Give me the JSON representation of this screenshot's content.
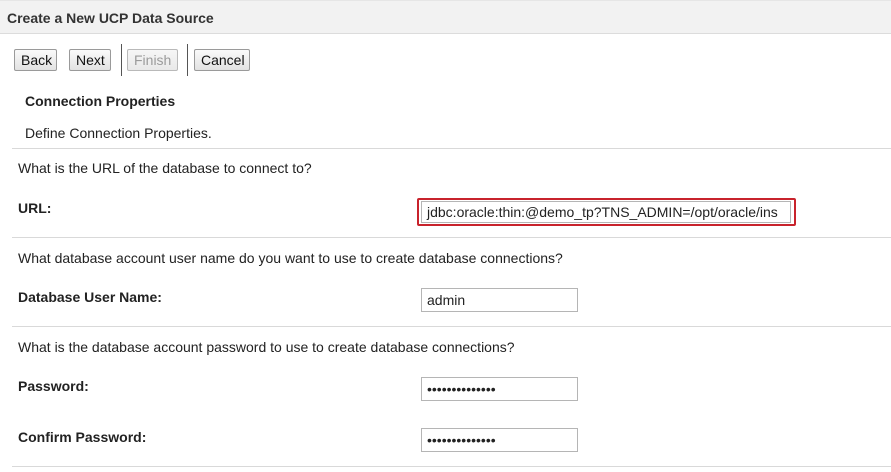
{
  "header": {
    "title": "Create a New UCP Data Source"
  },
  "toolbar": {
    "back_label": "Back",
    "next_label": "Next",
    "finish_label": "Finish",
    "cancel_label": "Cancel"
  },
  "section": {
    "title": "Connection Properties",
    "description": "Define Connection Properties."
  },
  "url_block": {
    "question": "What is the URL of the database to connect to?",
    "label": "URL:",
    "value": "jdbc:oracle:thin:@demo_tp?TNS_ADMIN=/opt/oracle/ins"
  },
  "user_block": {
    "question": "What database account user name do you want to use to create database connections?",
    "label": "Database User Name:",
    "value": "admin"
  },
  "password_block": {
    "question": "What is the database account password to use to create database connections?",
    "label": "Password:",
    "value": "••••••••••••••",
    "confirm_label": "Confirm Password:",
    "confirm_value": "••••••••••••••"
  },
  "colors": {
    "highlight": "#c8232c"
  }
}
